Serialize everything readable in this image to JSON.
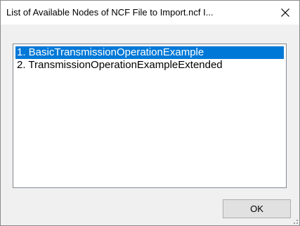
{
  "window": {
    "title": "List of Available Nodes of NCF File to Import.ncf I..."
  },
  "list": {
    "items": [
      {
        "label": "1. BasicTransmissionOperationExample",
        "selected": true
      },
      {
        "label": "2. TransmissionOperationExampleExtended",
        "selected": false
      }
    ]
  },
  "buttons": {
    "ok_label": "OK"
  },
  "icons": {
    "close": "close-icon",
    "grip": "resize-grip-icon"
  },
  "colors": {
    "selection": "#0078d7",
    "selection_text": "#ffffff",
    "dialog_bg": "#f0f0f0"
  }
}
